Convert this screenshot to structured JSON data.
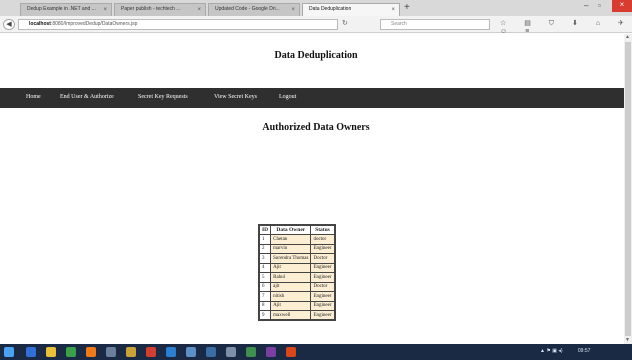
{
  "browser": {
    "tabs": [
      {
        "label": "Dedup Example in .NET and ..."
      },
      {
        "label": "Paper publish - techtech ..."
      },
      {
        "label": "Updated Code - Google Dri..."
      },
      {
        "label": "Data Deduplication"
      }
    ],
    "url_host": "localhost",
    "url_rest": ":8080/ImprovedDedup/DataOwners.jsp",
    "search_placeholder": "Search"
  },
  "page": {
    "heading": "Data Deduplication",
    "menu": [
      "Home",
      "End User & Authorize",
      "Secret Key Requests",
      "View Secret Keys",
      "Logout"
    ],
    "section_title": "Authorized Data Owners"
  },
  "table": {
    "headers": [
      "ID",
      "Data Owner",
      "Status"
    ],
    "rows": [
      [
        "1",
        "Chetan",
        "doctor"
      ],
      [
        "2",
        "marvin",
        "Engineer"
      ],
      [
        "3",
        "Surendra Thomas",
        "Doctor"
      ],
      [
        "4",
        "Ajit",
        "Engineer"
      ],
      [
        "5",
        "Rahul",
        "Engineer"
      ],
      [
        "6",
        "ajit",
        "Doctor"
      ],
      [
        "7",
        "nitish",
        "Engineer"
      ],
      [
        "8",
        "Ajit",
        "Engineer"
      ],
      [
        "9",
        "maxwell",
        "Engineer"
      ]
    ]
  },
  "taskbar": {
    "clock": "09:57"
  },
  "colors": {
    "menu_bg": "#2f2f2f",
    "cell_bg": "#fbeed3",
    "taskbar_bg": "#1a2a44"
  }
}
